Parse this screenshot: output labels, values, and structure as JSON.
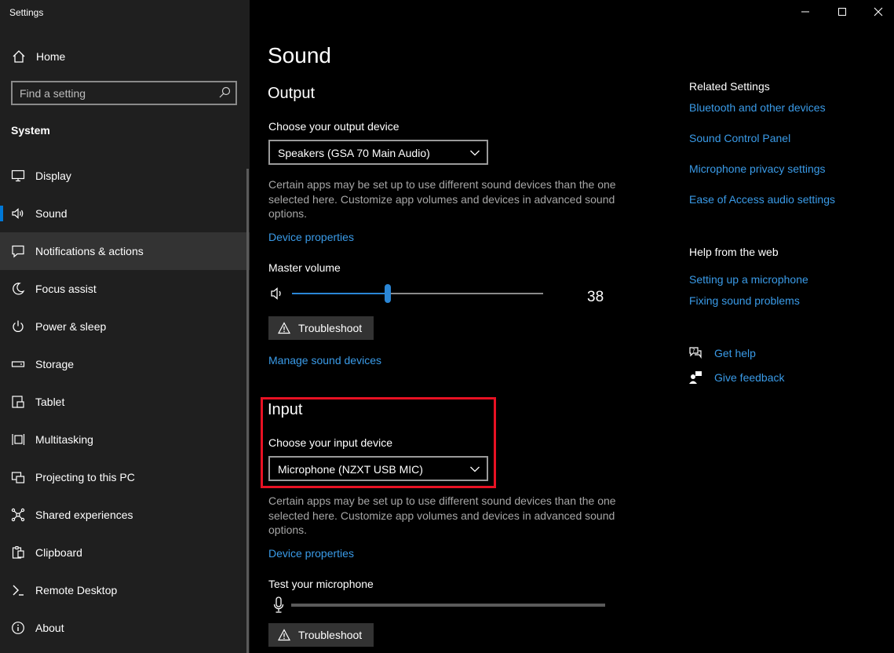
{
  "window": {
    "title": "Settings"
  },
  "sidebar": {
    "home_label": "Home",
    "search_placeholder": "Find a setting",
    "section": "System",
    "items": [
      {
        "label": "Display",
        "icon": "display-icon"
      },
      {
        "label": "Sound",
        "icon": "speaker-icon",
        "selected": true
      },
      {
        "label": "Notifications & actions",
        "icon": "notification-icon",
        "hover": true
      },
      {
        "label": "Focus assist",
        "icon": "moon-icon"
      },
      {
        "label": "Power & sleep",
        "icon": "power-icon"
      },
      {
        "label": "Storage",
        "icon": "storage-icon"
      },
      {
        "label": "Tablet",
        "icon": "tablet-icon"
      },
      {
        "label": "Multitasking",
        "icon": "multitasking-icon"
      },
      {
        "label": "Projecting to this PC",
        "icon": "projecting-icon"
      },
      {
        "label": "Shared experiences",
        "icon": "shared-icon"
      },
      {
        "label": "Clipboard",
        "icon": "clipboard-icon"
      },
      {
        "label": "Remote Desktop",
        "icon": "remote-desktop-icon"
      },
      {
        "label": "About",
        "icon": "info-icon"
      }
    ]
  },
  "main": {
    "title": "Sound",
    "output": {
      "heading": "Output",
      "device_label": "Choose your output device",
      "device_value": "Speakers (GSA 70 Main Audio)",
      "description": "Certain apps may be set up to use different sound devices than the one selected here. Customize app volumes and devices in advanced sound options.",
      "device_properties": "Device properties",
      "volume_label": "Master volume",
      "volume_value": "38",
      "volume_fraction": 0.38,
      "troubleshoot": "Troubleshoot",
      "manage": "Manage sound devices"
    },
    "input": {
      "heading": "Input",
      "device_label": "Choose your input device",
      "device_value": "Microphone (NZXT USB MIC)",
      "description": "Certain apps may be set up to use different sound devices than the one selected here. Customize app volumes and devices in advanced sound options.",
      "device_properties": "Device properties",
      "test_label": "Test your microphone",
      "troubleshoot": "Troubleshoot"
    }
  },
  "related": {
    "heading": "Related Settings",
    "links": [
      "Bluetooth and other devices",
      "Sound Control Panel",
      "Microphone privacy settings",
      "Ease of Access audio settings"
    ],
    "help_heading": "Help from the web",
    "help_links": [
      "Setting up a microphone",
      "Fixing sound problems"
    ],
    "get_help": "Get help",
    "give_feedback": "Give feedback"
  },
  "colors": {
    "accent": "#0078d7",
    "link": "#3a9be8",
    "highlight": "#e81123"
  }
}
